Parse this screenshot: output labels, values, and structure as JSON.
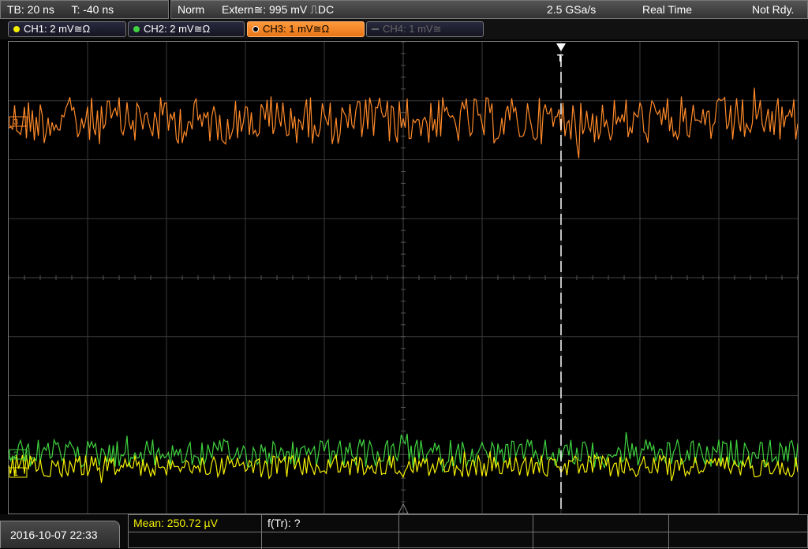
{
  "header": {
    "timebase": "TB: 20 ns",
    "trigger_time": "T: -40 ns",
    "mode": "Norm",
    "trigger_source": "Extern≅: 995 mV ⎍DC",
    "sample_rate": "2.5 GSa/s",
    "acq_mode": "Real Time",
    "status": "Not Rdy."
  },
  "channels": [
    {
      "label": "CH1: 2 mV≅Ω",
      "color": "#f5f000",
      "active": true
    },
    {
      "label": "CH2: 2 mV≅Ω",
      "color": "#3fd23f",
      "active": true
    },
    {
      "label": "CH3: 1 mV≅Ω",
      "color": "#ff8a2a",
      "active": true,
      "selected": true
    },
    {
      "label": "CH4: 1 mV≅",
      "color": "#666666",
      "active": false
    }
  ],
  "markers": {
    "trigger": "T",
    "ch1": "1",
    "ch2": "2",
    "ch3": "3"
  },
  "bottom": {
    "datetime": "2016-10-07 22:33",
    "measurement_1": "Mean: 250.72 µV",
    "measurement_2": "f(Tr): ?"
  },
  "colors": {
    "grid": "#3a3a3a",
    "ch1": "#f5f000",
    "ch2": "#3fd23f",
    "ch3": "#ff8a2a",
    "trigger_line": "#ffffff"
  }
}
